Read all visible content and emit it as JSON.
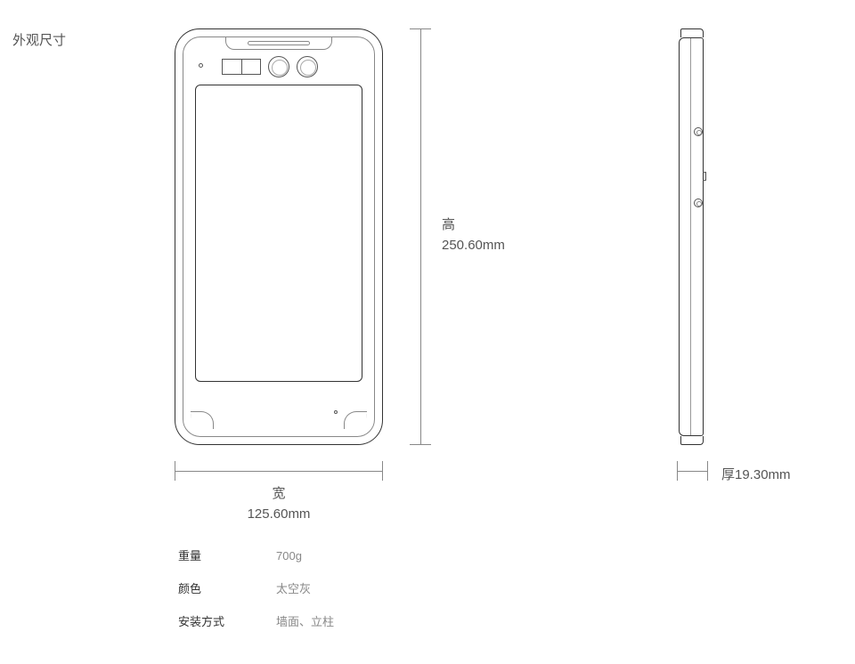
{
  "section_title": "外观尺寸",
  "dimensions": {
    "height": {
      "label": "高",
      "value": "250.60mm"
    },
    "width": {
      "label": "宽",
      "value": "125.60mm"
    },
    "thickness": {
      "label_value": "厚19.30mm"
    }
  },
  "specs": [
    {
      "label": "重量",
      "value": "700g"
    },
    {
      "label": "颜色",
      "value": "太空灰"
    },
    {
      "label": "安装方式",
      "value": "墙面、立柱"
    }
  ]
}
